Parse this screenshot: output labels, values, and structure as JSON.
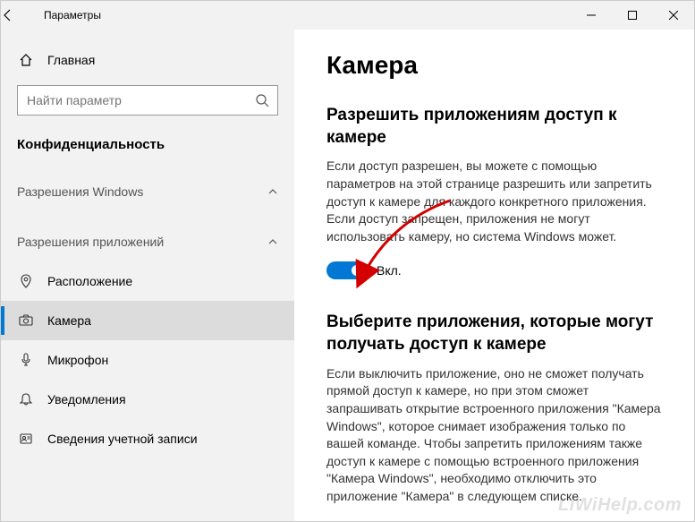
{
  "window": {
    "title": "Параметры"
  },
  "sidebar": {
    "home": "Главная",
    "search_placeholder": "Найти параметр",
    "current_section": "Конфиденциальность",
    "group1": "Разрешения Windows",
    "group2": "Разрешения приложений",
    "items": [
      {
        "label": "Расположение"
      },
      {
        "label": "Камера"
      },
      {
        "label": "Микрофон"
      },
      {
        "label": "Уведомления"
      },
      {
        "label": "Сведения учетной записи"
      }
    ]
  },
  "content": {
    "title": "Камера",
    "section1_h": "Разрешить приложениям доступ к камере",
    "section1_p": "Если доступ разрешен, вы можете с помощью параметров на этой странице разрешить или запретить доступ к камере для каждого конкретного приложения. Если доступ запрещен, приложения не могут использовать камеру, но система Windows может.",
    "toggle_label": "Вкл.",
    "section2_h": "Выберите приложения, которые могут получать доступ к камере",
    "section2_p": "Если выключить приложение, оно не сможет получать прямой доступ к камере, но при этом сможет запрашивать открытие встроенного приложения \"Камера Windows\", которое снимает изображения только по вашей команде. Чтобы запретить приложениям также доступ к камере с помощью встроенного приложения \"Камера Windows\", необходимо отключить это приложение \"Камера\" в следующем списке."
  },
  "watermark": "LiWiHelp.com"
}
